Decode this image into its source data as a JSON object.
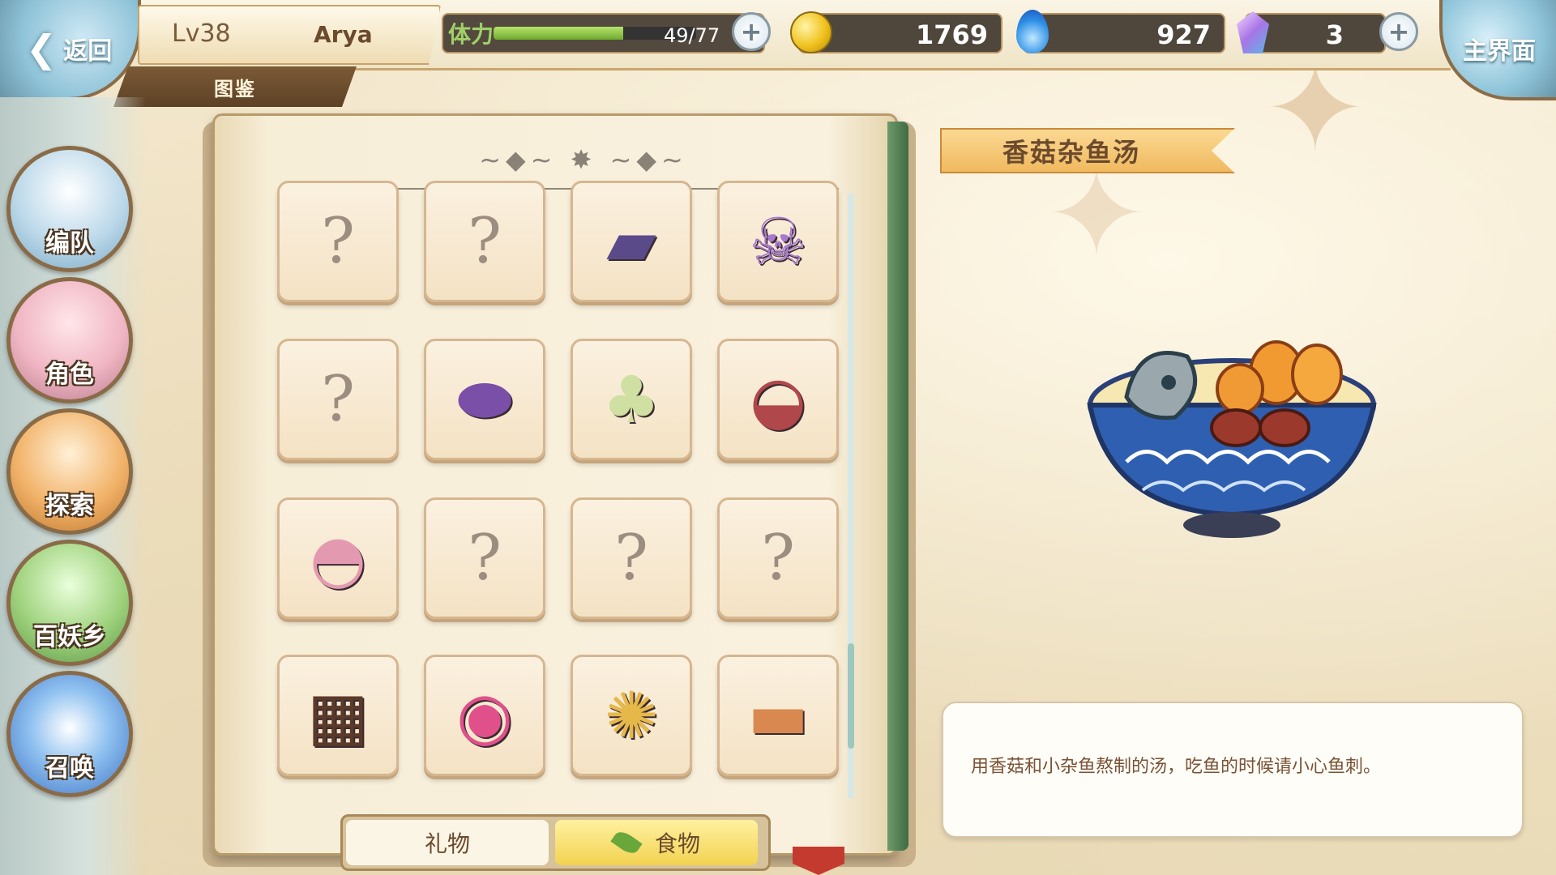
{
  "header": {
    "back_label": "返回",
    "home_label": "主界面",
    "level": "Lv38",
    "player_name": "Arya",
    "section_tab": "图鉴"
  },
  "resources": {
    "stamina_label": "体力",
    "stamina_text": "49/77",
    "stamina_fraction": 0.64,
    "gold": "1769",
    "spirit_fire": "927",
    "crystal": "3"
  },
  "sidebar": {
    "items": [
      {
        "label": "编队",
        "color": "#d84b3c"
      },
      {
        "label": "角色",
        "color": "#e58fa0"
      },
      {
        "label": "探索",
        "color": "#e79a4a"
      },
      {
        "label": "百妖乡",
        "color": "#7fbf6a"
      },
      {
        "label": "召唤",
        "color": "#5a8fd6"
      }
    ]
  },
  "codex": {
    "question_mark": "?",
    "scroll_position": 0.9,
    "items": [
      {
        "icon": "unknown-item-icon",
        "unlocked": false
      },
      {
        "icon": "unknown-item-icon",
        "unlocked": false
      },
      {
        "icon": "seaweed-jelly-icon",
        "unlocked": true,
        "color": "#5a4a8a"
      },
      {
        "icon": "skull-cake-icon",
        "unlocked": true,
        "color": "#a77ad0"
      },
      {
        "icon": "unknown-item-icon",
        "unlocked": false
      },
      {
        "icon": "purple-mushroom-rock-icon",
        "unlocked": true,
        "color": "#7a4fa8"
      },
      {
        "icon": "mushroom-cream-icon",
        "unlocked": true,
        "color": "#cfe0a2"
      },
      {
        "icon": "octopus-rice-bowl-icon",
        "unlocked": true,
        "color": "#b0474a"
      },
      {
        "icon": "brain-soup-bowl-icon",
        "unlocked": true,
        "color": "#e39ab0"
      },
      {
        "icon": "unknown-item-icon",
        "unlocked": false
      },
      {
        "icon": "unknown-item-icon",
        "unlocked": false
      },
      {
        "icon": "unknown-item-icon",
        "unlocked": false
      },
      {
        "icon": "chocolate-basket-icon",
        "unlocked": true,
        "color": "#5b3a2a"
      },
      {
        "icon": "pink-stew-pot-icon",
        "unlocked": true,
        "color": "#e0508a"
      },
      {
        "icon": "fried-nuggets-icon",
        "unlocked": true,
        "color": "#e6b84a"
      },
      {
        "icon": "grilled-fish-plate-icon",
        "unlocked": true,
        "color": "#d98850"
      }
    ]
  },
  "tabs": {
    "gift": "礼物",
    "food": "食物",
    "active": "food"
  },
  "detail": {
    "name": "香菇杂鱼汤",
    "description": "用香菇和小杂鱼熬制的汤，吃鱼的时候请小心鱼刺。",
    "image_icon": "mushroom-fish-soup-icon"
  }
}
